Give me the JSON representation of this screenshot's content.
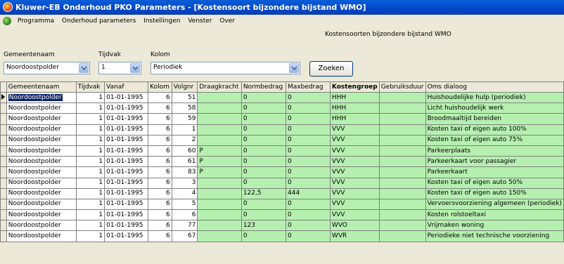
{
  "window": {
    "title": "Kluwer-EB Onderhoud PKO Parameters - [Kostensoort bijzondere bijstand WMO]"
  },
  "menu": [
    "Programma",
    "Onderhoud parameters",
    "Instellingen",
    "Venster",
    "Over"
  ],
  "form": {
    "subtitle": "Kostensoorten bijzondere bijstand WMO",
    "gemeentenaam_label": "Gemeentenaam",
    "gemeentenaam_value": "Noordoostpolder",
    "tijdvak_label": "Tijdvak",
    "tijdvak_value": "1",
    "kolom_label": "Kolom",
    "kolom_value": "Periodiek",
    "search_label": "Zoeken"
  },
  "grid": {
    "columns": [
      "Gemeentenaam",
      "Tijdvak",
      "Vanaf",
      "Kolom",
      "Volgnr",
      "Draagkracht",
      "Normbedrag",
      "Maxbedrag",
      "Kostengroep",
      "Gebruiksduur",
      "Oms dialoog"
    ],
    "rows": [
      [
        "Noordoostpolder",
        "1",
        "01-01-1995",
        "6",
        "51",
        "",
        "0",
        "0",
        "HHH",
        "",
        "Huishoudelijke hulp (periodiek)"
      ],
      [
        "Noordoostpolder",
        "1",
        "01-01-1995",
        "6",
        "58",
        "",
        "0",
        "0",
        "HHH",
        "",
        "Licht huishoudelijk werk"
      ],
      [
        "Noordoostpolder",
        "1",
        "01-01-1995",
        "6",
        "59",
        "",
        "0",
        "0",
        "HHH",
        "",
        "Broodmaaltijd bereiden"
      ],
      [
        "Noordoostpolder",
        "1",
        "01-01-1995",
        "6",
        "1",
        "",
        "0",
        "0",
        "VVV",
        "",
        "Kosten taxi of eigen auto 100%"
      ],
      [
        "Noordoostpolder",
        "1",
        "01-01-1995",
        "6",
        "2",
        "",
        "0",
        "0",
        "VVV",
        "",
        "Kosten taxi of eigen auto 75%"
      ],
      [
        "Noordoostpolder",
        "1",
        "01-01-1995",
        "6",
        "60",
        "P",
        "0",
        "0",
        "VVV",
        "",
        "Parkeerplaats"
      ],
      [
        "Noordoostpolder",
        "1",
        "01-01-1995",
        "6",
        "61",
        "P",
        "0",
        "0",
        "VVV",
        "",
        "Parkeerkaart voor passagier"
      ],
      [
        "Noordoostpolder",
        "1",
        "01-01-1995",
        "6",
        "83",
        "P",
        "0",
        "0",
        "VVV",
        "",
        "Parkeerkaart"
      ],
      [
        "Noordoostpolder",
        "1",
        "01-01-1995",
        "6",
        "3",
        "",
        "0",
        "0",
        "VVV",
        "",
        "Kosten taxi of eigen auto 50%"
      ],
      [
        "Noordoostpolder",
        "1",
        "01-01-1995",
        "6",
        "4",
        "",
        "122,5",
        "444",
        "VVV",
        "",
        "Kosten taxi of eigen auto 150%"
      ],
      [
        "Noordoostpolder",
        "1",
        "01-01-1995",
        "6",
        "5",
        "",
        "0",
        "0",
        "VVV",
        "",
        "Vervoersvoorziening algemeen (periodiek)"
      ],
      [
        "Noordoostpolder",
        "1",
        "01-01-1995",
        "6",
        "6",
        "",
        "0",
        "0",
        "VVV",
        "",
        "Kosten rolstoeltaxi"
      ],
      [
        "Noordoostpolder",
        "1",
        "01-01-1995",
        "6",
        "77",
        "",
        "123",
        "0",
        "WVO",
        "",
        "Vrijmaken woning"
      ],
      [
        "Noordoostpolder",
        "1",
        "01-01-1995",
        "6",
        "67",
        "",
        "0",
        "0",
        "WVR",
        "",
        "Periodieke niet technische voorziening"
      ]
    ]
  },
  "colors": {
    "titlebar": "#0346c9",
    "green_cell": "#b6f0b0",
    "selection": "#0a246a"
  }
}
